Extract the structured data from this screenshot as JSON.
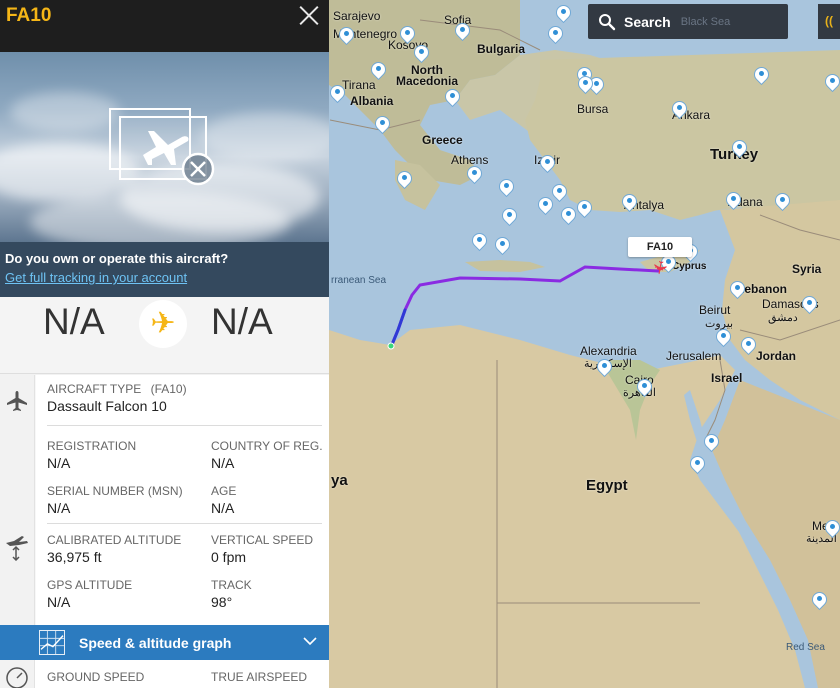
{
  "panel": {
    "title": "FA10",
    "own_question": "Do you own or operate this aircraft?",
    "own_link": "Get full tracking in your account",
    "route": {
      "origin": "N/A",
      "destination": "N/A"
    },
    "aircraft_type_label": "AIRCRAFT TYPE",
    "aircraft_type_code": "(FA10)",
    "aircraft_type_value": "Dassault Falcon 10",
    "registration_label": "REGISTRATION",
    "registration_value": "N/A",
    "country_label": "COUNTRY OF REG.",
    "country_value": "N/A",
    "serial_label": "SERIAL NUMBER (MSN)",
    "serial_value": "N/A",
    "age_label": "AGE",
    "age_value": "N/A",
    "cal_alt_label": "CALIBRATED ALTITUDE",
    "cal_alt_value": "36,975 ft",
    "vert_speed_label": "VERTICAL SPEED",
    "vert_speed_value": "0 fpm",
    "gps_alt_label": "GPS ALTITUDE",
    "gps_alt_value": "N/A",
    "track_label": "TRACK",
    "track_value": "98°",
    "graph_label": "Speed & altitude graph",
    "ground_speed_label": "GROUND SPEED",
    "true_airspeed_label": "TRUE AIRSPEED"
  },
  "search": {
    "label": "Search",
    "placeholder": "Black Sea"
  },
  "map": {
    "aircraft_label": "FA10",
    "labels": {
      "sarajevo": "Sarajevo",
      "montenegro": "Montenegro",
      "kosovo": "Kosovo",
      "sofia": "Sofia",
      "bulgaria": "Bulgaria",
      "tirana": "Tirana",
      "north_macedonia_1": "North",
      "north_macedonia_2": "Macedonia",
      "albania": "Albania",
      "bursa": "Bursa",
      "ankara": "Ankara",
      "greece": "Greece",
      "athens": "Athens",
      "izmir": "Izmir",
      "turkey": "Turkey",
      "antalya": "Antalya",
      "adana": "Adana",
      "cyprus": "Cyprus",
      "syria": "Syria",
      "lebanon": "Lebanon",
      "damascus": "Damascus",
      "damascus_ar": "دمشق",
      "beirut": "Beirut",
      "beirut_ar": "بيروت",
      "jerusalem": "Jerusalem",
      "jordan": "Jordan",
      "israel": "Israel",
      "alexandria": "Alexandria",
      "alexandria_ar": "الإسكندرية",
      "cairo": "Cairo",
      "cairo_ar": "القاهرة",
      "egypt": "Egypt",
      "mediterranean": "rranean Sea",
      "red_sea": "Red Sea",
      "libya": "ya",
      "medina": "Medi",
      "medina_ar": "المدينة"
    }
  },
  "colors": {
    "brand_yellow": "#f5b617",
    "panel_dark": "#1e1e1e",
    "link_blue": "#6ec3f4",
    "graph_bar": "#2c7bbf",
    "track_purple": "#8a2be2"
  }
}
